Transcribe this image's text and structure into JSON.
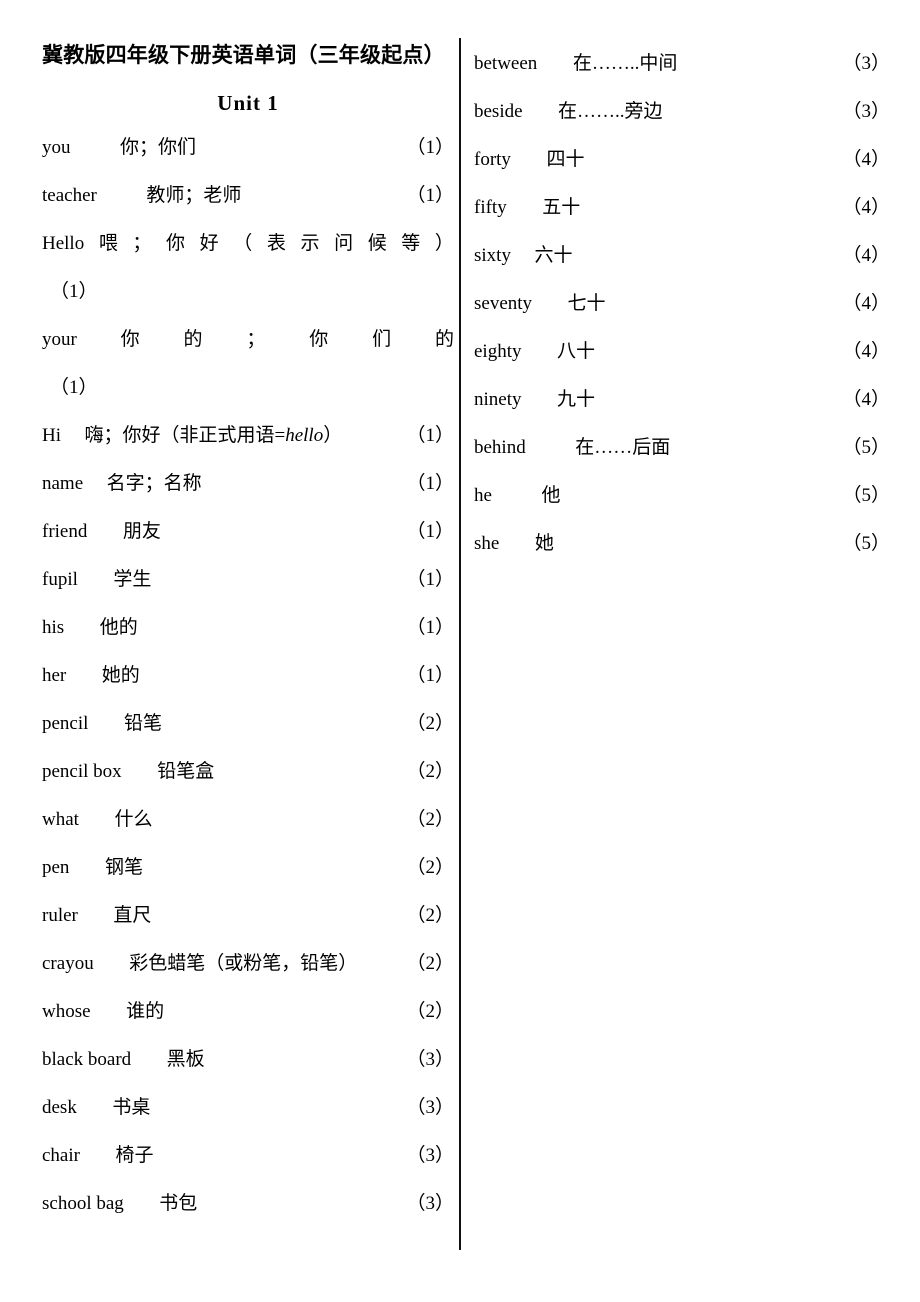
{
  "document": {
    "title": "冀教版四年级下册英语单词（三年级起点）",
    "unit_heading": "Unit    1"
  },
  "left_column": {
    "entries": [
      {
        "term": "you",
        "meaning": "你；你们",
        "page_ref": "（1）"
      },
      {
        "term": "teacher",
        "meaning": "教师；老师",
        "page_ref": "（1）"
      },
      {
        "term": "Hi",
        "meaning_pre": "嗨；你好（非正式用语=",
        "meaning_italic": "hello",
        "meaning_post": "）",
        "page_ref": "（1）"
      },
      {
        "term": "name",
        "meaning": "名字；名称",
        "page_ref": "（1）"
      },
      {
        "term": "friend",
        "meaning": "朋友",
        "page_ref": "（1）"
      },
      {
        "term": "fupil",
        "meaning": "学生",
        "page_ref": "（1）"
      },
      {
        "term": "his",
        "meaning": "他的",
        "page_ref": "（1）"
      },
      {
        "term": "her",
        "meaning": "她的",
        "page_ref": "（1）"
      },
      {
        "term": "pencil",
        "meaning": "铅笔",
        "page_ref": "（2）"
      },
      {
        "term": "pencil box",
        "meaning": "铅笔盒",
        "page_ref": "（2）"
      },
      {
        "term": "what",
        "meaning": "什么",
        "page_ref": "（2）"
      },
      {
        "term": "pen",
        "meaning": "钢笔",
        "page_ref": "（2）"
      },
      {
        "term": "ruler",
        "meaning": "直尺",
        "page_ref": "（2）"
      },
      {
        "term": "crayou",
        "meaning": "彩色蜡笔（或粉笔，铅笔）",
        "page_ref": "（2）"
      },
      {
        "term": "whose",
        "meaning": "谁的",
        "page_ref": "（2）"
      },
      {
        "term": "black board",
        "meaning": "黑板",
        "page_ref": "（3）"
      },
      {
        "term": "desk",
        "meaning": "书桌",
        "page_ref": "（3）"
      },
      {
        "term": "chair",
        "meaning": "椅子",
        "page_ref": "（3）"
      },
      {
        "term": "school bag",
        "meaning": "书包",
        "page_ref": "（3）"
      }
    ],
    "wrapped_entries": {
      "hello": {
        "term": "Hello",
        "meaning_chars": [
          "喂",
          "；",
          "你",
          "好",
          "（",
          "表",
          "示",
          "问",
          "候",
          "等",
          "）"
        ],
        "page_ref": "（1）"
      },
      "your": {
        "term": "your",
        "meaning_chars": [
          "你",
          "的",
          "；",
          "你",
          "们",
          "的"
        ],
        "page_ref": "（1）"
      }
    }
  },
  "right_column": {
    "entries": [
      {
        "term": "between",
        "meaning": "在……..中间",
        "page_ref": "（3）"
      },
      {
        "term": "beside",
        "meaning": "在……..旁边",
        "page_ref": "（3）"
      },
      {
        "term": "forty",
        "meaning": "四十",
        "page_ref": "（4）"
      },
      {
        "term": "fifty",
        "meaning": "五十",
        "page_ref": "（4）"
      },
      {
        "term": "sixty",
        "meaning": "六十",
        "page_ref": "（4）"
      },
      {
        "term": "seventy",
        "meaning": "七十",
        "page_ref": "（4）"
      },
      {
        "term": "eighty",
        "meaning": "八十",
        "page_ref": "（4）"
      },
      {
        "term": "ninety",
        "meaning": "九十",
        "page_ref": "（4）"
      },
      {
        "term": "behind",
        "meaning": "在……后面",
        "page_ref": "（5）"
      },
      {
        "term": "he",
        "meaning": "他",
        "page_ref": "（5）"
      },
      {
        "term": "she",
        "meaning": "她",
        "page_ref": "（5）"
      }
    ]
  }
}
